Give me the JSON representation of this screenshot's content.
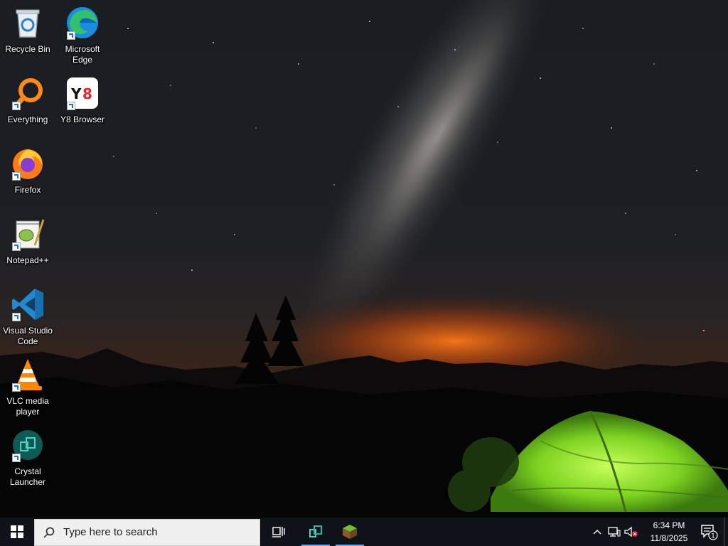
{
  "desktop": {
    "icons": [
      {
        "label": "Recycle Bin",
        "icon": "recycle-bin-icon"
      },
      {
        "label": "Microsoft Edge",
        "icon": "edge-icon"
      },
      {
        "label": "Everything",
        "icon": "everything-search-icon"
      },
      {
        "label": "Y8 Browser",
        "icon": "y8-browser-icon"
      },
      {
        "label": "Firefox",
        "icon": "firefox-icon"
      },
      {
        "label": "Notepad++",
        "icon": "notepad-plus-plus-icon"
      },
      {
        "label": "Visual Studio Code",
        "icon": "vscode-icon"
      },
      {
        "label": "VLC media player",
        "icon": "vlc-icon"
      },
      {
        "label": "Crystal Launcher",
        "icon": "crystal-launcher-icon"
      }
    ]
  },
  "taskbar": {
    "search_placeholder": "Type here to search",
    "pinned": [
      {
        "icon": "crystal-launcher-icon",
        "running": true
      },
      {
        "icon": "minecraft-grass-block-icon",
        "running": true
      }
    ],
    "clock": {
      "time": "6:34 PM",
      "date": "11/8/2025"
    },
    "notifications_count": "1"
  },
  "colors": {
    "taskbar_bg": "#0f1218",
    "accent_running": "#6aa5e8",
    "tent_green": "#8fe13a"
  }
}
